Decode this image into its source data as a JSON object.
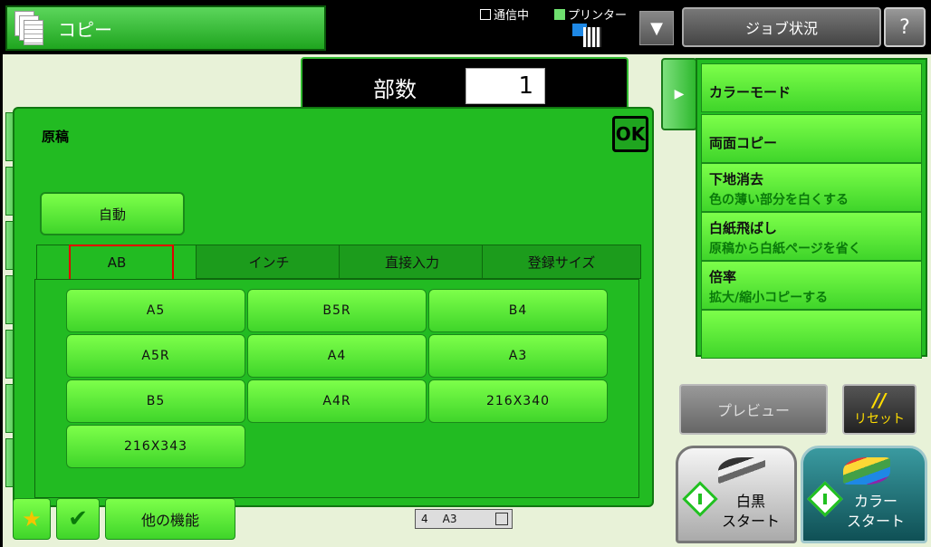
{
  "header": {
    "mode_label": "コピー",
    "comm_label": "通信中",
    "printer_label": "プリンター",
    "dropdown_glyph": "▼",
    "job_status_label": "ジョブ状況",
    "help_glyph": "?"
  },
  "copies": {
    "label": "部数",
    "value": "1"
  },
  "dialog": {
    "title": "原稿",
    "ok_label": "OK",
    "auto_label": "自動",
    "tabs": [
      {
        "label": "AB",
        "selected": true
      },
      {
        "label": "インチ"
      },
      {
        "label": "直接入力"
      },
      {
        "label": "登録サイズ"
      }
    ],
    "sizes": [
      "A5",
      "B5R",
      "B4",
      "A5R",
      "A4",
      "A3",
      "B5",
      "A4R",
      "216X340",
      "216X343"
    ]
  },
  "right_menu": {
    "items": [
      {
        "title": "カラーモード",
        "sub": ""
      },
      {
        "title": "両面コピー",
        "sub": ""
      },
      {
        "title": "下地消去",
        "sub": "色の薄い部分を白くする"
      },
      {
        "title": "白紙飛ばし",
        "sub": "原稿から白紙ページを省く"
      },
      {
        "title": "倍率",
        "sub": "拡大/縮小コピーする"
      }
    ]
  },
  "actions": {
    "preview_label": "プレビュー",
    "reset_symbol": "//",
    "reset_label": "リセット",
    "bw_start_line1": "白黒",
    "bw_start_line2": "スタート",
    "color_start_line1": "カラー",
    "color_start_line2": "スタート"
  },
  "bottom": {
    "other_functions_label": "他の機能",
    "tray_number": "4",
    "tray_size": "A3"
  },
  "colors": {
    "accent_green": "#22bb22",
    "button_green": "#5fe53a",
    "highlight_red": "#e00000"
  }
}
